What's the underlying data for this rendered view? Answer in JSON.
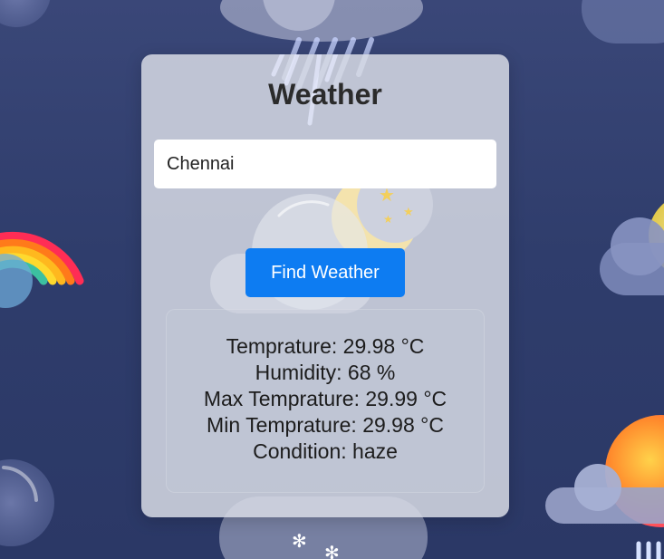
{
  "app": {
    "title": "Weather"
  },
  "search": {
    "value": "Chennai"
  },
  "button": {
    "label": "Find Weather"
  },
  "results": {
    "temperature": "Temprature: 29.98 °C",
    "humidity": "Humidity: 68 %",
    "max_temperature": "Max Temprature: 29.99 °C",
    "min_temperature": "Min Temprature: 29.98 °C",
    "condition": "Condition: haze"
  },
  "colors": {
    "background": "#323f6e",
    "button": "#0d7cf2",
    "card": "#d6dae4"
  },
  "icons": [
    "rainbow-icon",
    "cloud-icon",
    "rain-icon",
    "moon-stars-icon",
    "sun-cloud-icon",
    "snow-icon",
    "bubble-icon"
  ]
}
